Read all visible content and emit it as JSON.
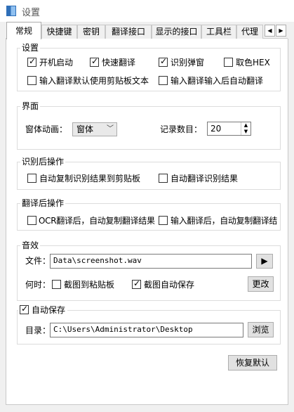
{
  "window": {
    "title": "设置"
  },
  "tabs": [
    {
      "label": "常规"
    },
    {
      "label": "快捷键"
    },
    {
      "label": "密钥"
    },
    {
      "label": "翻译接口"
    },
    {
      "label": "显示的接口"
    },
    {
      "label": "工具栏"
    },
    {
      "label": "代理"
    }
  ],
  "tab_scroll": {
    "left": "◀",
    "right": "▶"
  },
  "settings_group": {
    "title": "设置",
    "auto_start": {
      "label": "开机启动",
      "checked": true
    },
    "quick_translate": {
      "label": "快速翻译",
      "checked": true
    },
    "ocr_popup": {
      "label": "识别弹窗",
      "checked": true
    },
    "color_hex": {
      "label": "取色HEX",
      "checked": false
    },
    "clipboard_default": {
      "label": "输入翻译默认使用剪贴板文本",
      "checked": false
    },
    "auto_translate_after_input": {
      "label": "输入翻译输入后自动翻译",
      "checked": false
    }
  },
  "ui_group": {
    "title": "界面",
    "animation_label": "窗体动画：",
    "animation_value": "窗体",
    "record_label": "记录数目：",
    "record_value": "20"
  },
  "after_ocr_group": {
    "title": "识别后操作",
    "copy_result": {
      "label": "自动复制识别结果到剪贴板",
      "checked": false
    },
    "translate_result": {
      "label": "自动翻译识别结果",
      "checked": false
    }
  },
  "after_translate_group": {
    "title": "翻译后操作",
    "ocr_copy": {
      "label": "OCR翻译后，自动复制翻译结果",
      "checked": false
    },
    "input_copy": {
      "label": "输入翻译后，自动复制翻译结",
      "checked": false
    }
  },
  "sound_group": {
    "title": "音效",
    "file_label": "文件：",
    "file_value": "Data\\screenshot.wav",
    "play_icon": "▶",
    "when_label": "何时：",
    "to_clipboard": {
      "label": "截图到粘贴板",
      "checked": false
    },
    "auto_save_shot": {
      "label": "截图自动保存",
      "checked": true
    },
    "change_button": "更改"
  },
  "autosave_group": {
    "title": "自动保存",
    "checked": true,
    "dir_label": "目录：",
    "dir_value": "C:\\Users\\Administrator\\Desktop",
    "browse_button": "浏览"
  },
  "restore_button": "恢复默认"
}
